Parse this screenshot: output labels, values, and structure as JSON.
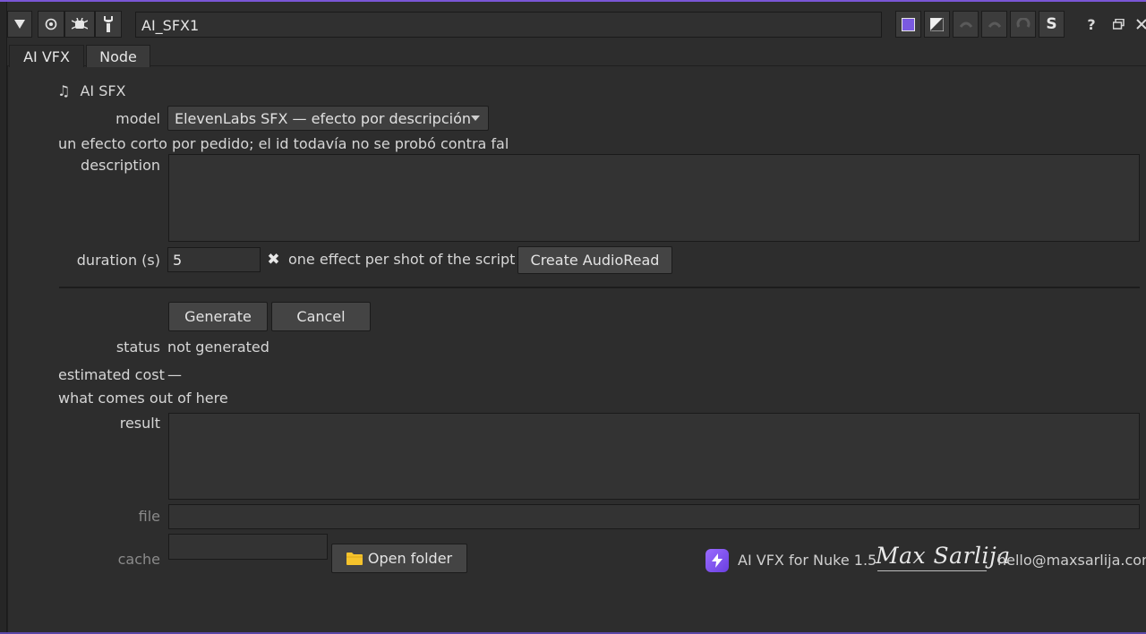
{
  "header": {
    "node_name": "AI_SFX1"
  },
  "tabs": [
    {
      "label": "AI VFX"
    },
    {
      "label": "Node"
    }
  ],
  "section": {
    "icon": "♫",
    "title": "AI SFX"
  },
  "form": {
    "model_label": "model",
    "model_value": "ElevenLabs SFX — efecto por descripción",
    "model_note": "un efecto corto por pedido; el id todavía no se probó contra fal",
    "description_label": "description",
    "description_value": "",
    "duration_label": "duration (s)",
    "duration_value": "5",
    "per_shot_label": "one effect per shot of the script",
    "per_shot_checked": true,
    "create_audioread_label": "Create AudioRead",
    "generate_label": "Generate",
    "cancel_label": "Cancel",
    "status_label": "status",
    "status_value": "not generated",
    "cost_label": "estimated cost",
    "cost_value": "—",
    "output_heading": "what comes out of here",
    "result_label": "result",
    "result_value": "",
    "file_label": "file",
    "file_value": "",
    "cache_label": "cache",
    "cache_value": "",
    "open_folder_label": "Open folder"
  },
  "footer": {
    "product": "AI VFX for Nuke 1.5",
    "signature": "Max Sarlija",
    "email": "hello@maxsarlija.com"
  },
  "colors": {
    "accent": "#7a56d6",
    "brand": "#8a5cff",
    "panel": "#2d2d2d"
  }
}
